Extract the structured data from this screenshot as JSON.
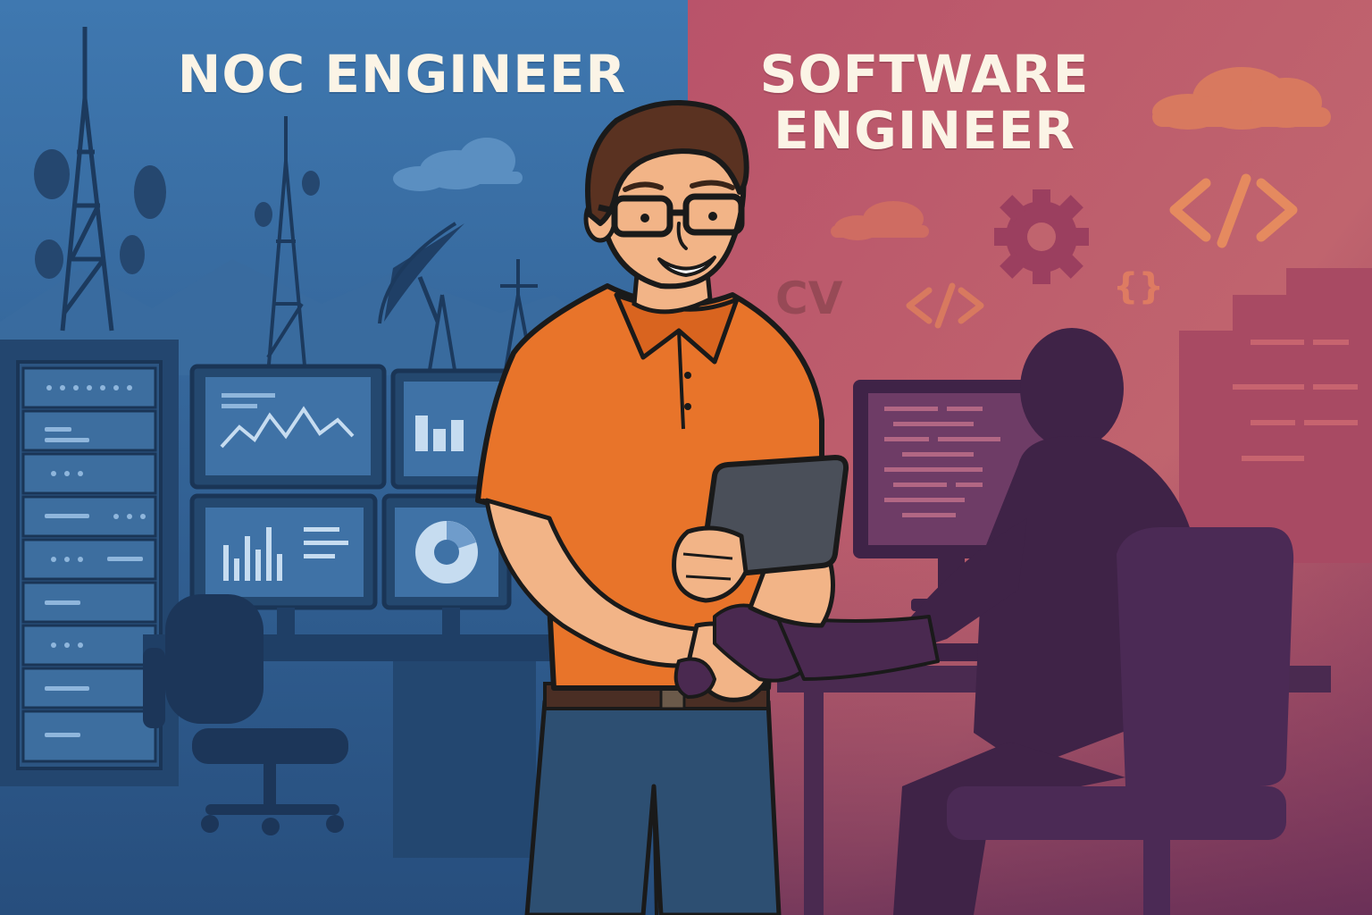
{
  "headings": {
    "left": "NOC ENGINEER",
    "right_line1": "SOFTWARE",
    "right_line2": "ENGINEER"
  },
  "decor": {
    "cv_text": "CV",
    "code_tag_large": "</>",
    "code_tag_small": "</>",
    "braces": "{}"
  },
  "colors": {
    "left_bg": "#2f6296",
    "right_bg": "#b4566a",
    "shirt": "#e8742a",
    "skin": "#f2b487",
    "jeans": "#2d4f72",
    "silhouette": "#3f2347",
    "heading_text": "#fbf4e6"
  },
  "icons": [
    "cell-tower-icon",
    "satellite-dish-icon",
    "server-rack-icon",
    "monitor-icon",
    "gear-icon",
    "code-tag-icon",
    "cloud-icon",
    "office-chair-icon"
  ]
}
